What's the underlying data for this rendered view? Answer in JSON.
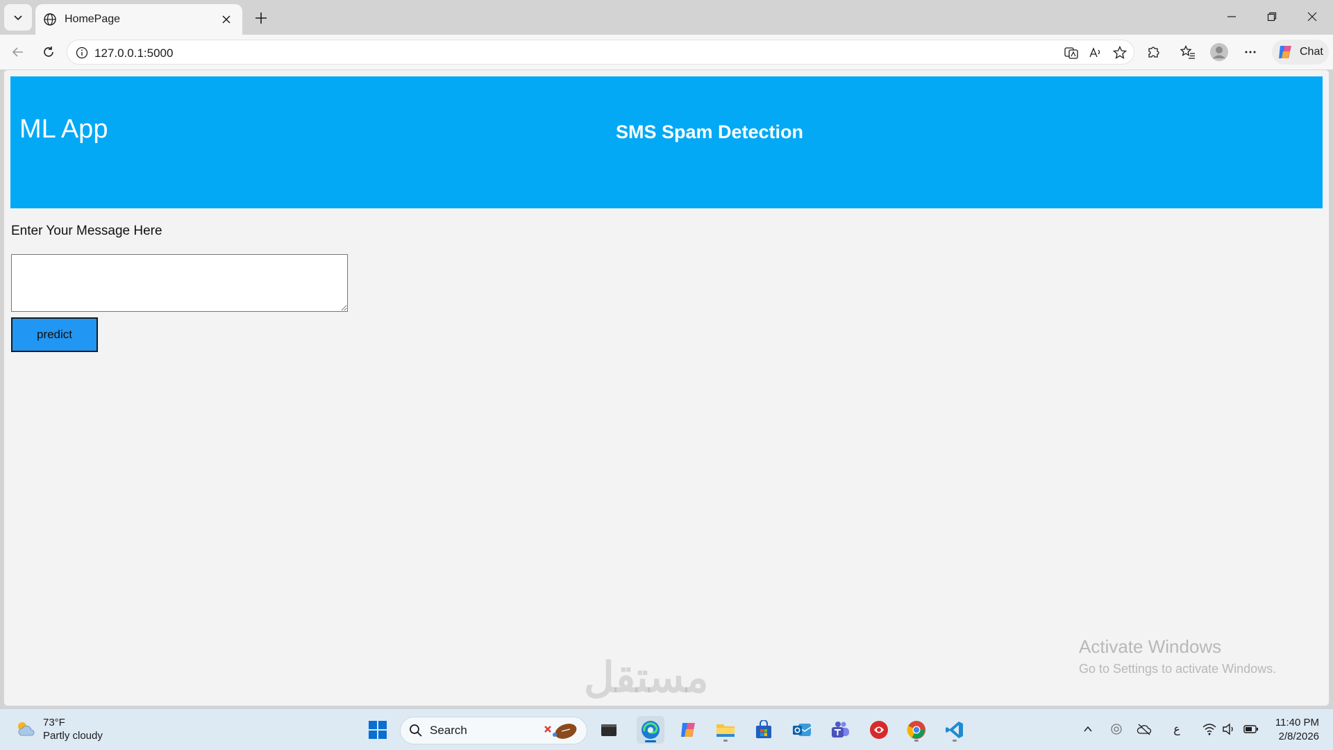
{
  "browser": {
    "tab_title": "HomePage",
    "url": "127.0.0.1:5000",
    "chat_label": "Chat"
  },
  "page": {
    "logo": "ML App",
    "title": "SMS Spam Detection",
    "message_label": "Enter Your Message Here",
    "message_value": "",
    "predict_label": "predict",
    "header_color": "#03a9f4",
    "button_color": "#2196f3"
  },
  "activation": {
    "heading": "Activate Windows",
    "subtext": "Go to Settings to activate Windows."
  },
  "watermark": "مستقل",
  "taskbar": {
    "weather_temp": "73°F",
    "weather_desc": "Partly cloudy",
    "search_label": "Search",
    "time": "11:40 PM",
    "date": "2/8/2026",
    "lang_indicator": "ع"
  }
}
